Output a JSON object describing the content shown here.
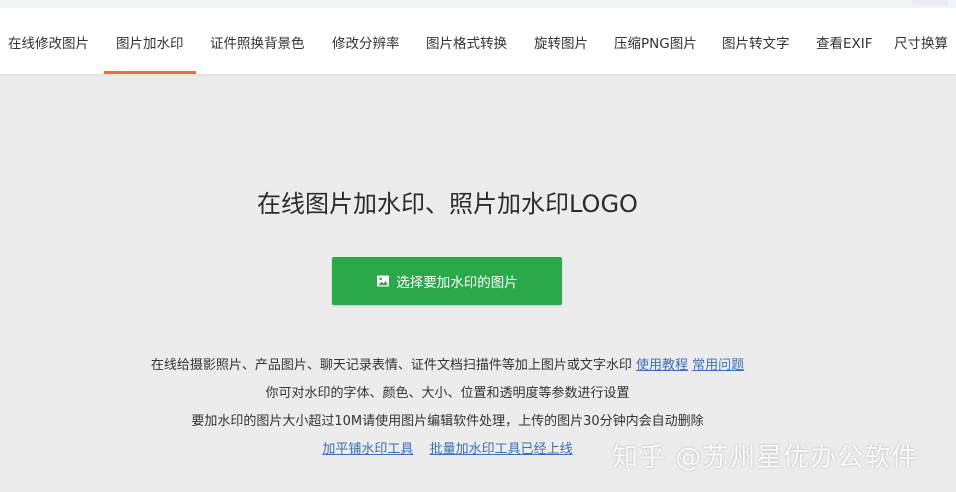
{
  "nav": {
    "tabs": [
      {
        "label": "在线修改图片",
        "active": false
      },
      {
        "label": "图片加水印",
        "active": true
      },
      {
        "label": "证件照换背景色",
        "active": false
      },
      {
        "label": "修改分辨率",
        "active": false
      },
      {
        "label": "图片格式转换",
        "active": false
      },
      {
        "label": "旋转图片",
        "active": false
      },
      {
        "label": "压缩PNG图片",
        "active": false
      },
      {
        "label": "图片转文字",
        "active": false
      },
      {
        "label": "查看EXIF",
        "active": false
      },
      {
        "label": "尺寸换算",
        "active": false
      }
    ],
    "active_color": "#f26b3a"
  },
  "main": {
    "title": "在线图片加水印、照片加水印LOGO",
    "upload_button": {
      "label": "选择要加水印的图片",
      "icon": "image-icon",
      "color": "#2aa84a"
    },
    "line1_text": "在线给摄影照片、产品图片、聊天记录表情、证件文档扫描件等加上图片或文字水印",
    "tutorial_link": "使用教程",
    "faq_link": "常用问题",
    "line2_text": "你可对水印的字体、颜色、大小、位置和透明度等参数进行设置",
    "line3_text": "要加水印的图片大小超过10M请使用图片编辑软件处理，上传的图片30分钟内会自动删除",
    "tile_tool_link": "加平铺水印工具",
    "batch_tool_link": "批量加水印工具已经上线",
    "link_color": "#3a6fb5"
  },
  "watermark": {
    "text": "知乎 @苏州星优办公软件"
  }
}
